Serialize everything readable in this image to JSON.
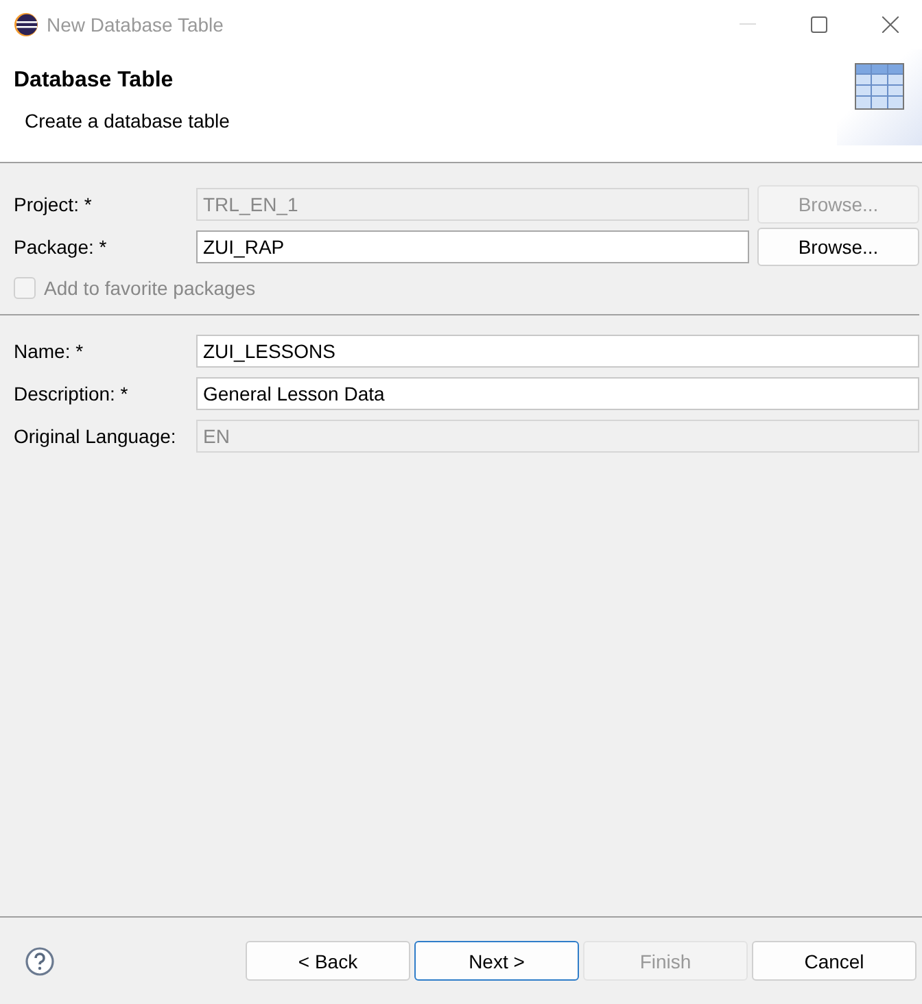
{
  "window": {
    "title": "New Database Table"
  },
  "header": {
    "title": "Database Table",
    "subtitle": "Create a database table"
  },
  "package_section": [
    {
      "label": "Project: *",
      "value": "TRL_EN_1",
      "disabled": true,
      "browse": {
        "label": "Browse...",
        "disabled": true
      }
    },
    {
      "label": "Package: *",
      "value": "ZUI_RAP",
      "disabled": false,
      "browse": {
        "label": "Browse...",
        "disabled": false
      }
    }
  ],
  "favorite_checkbox": {
    "label": "Add to favorite packages",
    "checked": false,
    "disabled": true
  },
  "details_section": [
    {
      "label": "Name: *",
      "value": "ZUI_LESSONS",
      "disabled": false
    },
    {
      "label": "Description: *",
      "value": "General Lesson Data",
      "disabled": false
    },
    {
      "label": "Original Language:",
      "value": "EN",
      "disabled": true
    }
  ],
  "buttons": [
    {
      "label": "< Back",
      "disabled": false,
      "selected": false
    },
    {
      "label": "Next >",
      "disabled": false,
      "selected": true
    },
    {
      "label": "Finish",
      "disabled": true,
      "selected": false
    },
    {
      "label": "Cancel",
      "disabled": false,
      "selected": false
    }
  ]
}
